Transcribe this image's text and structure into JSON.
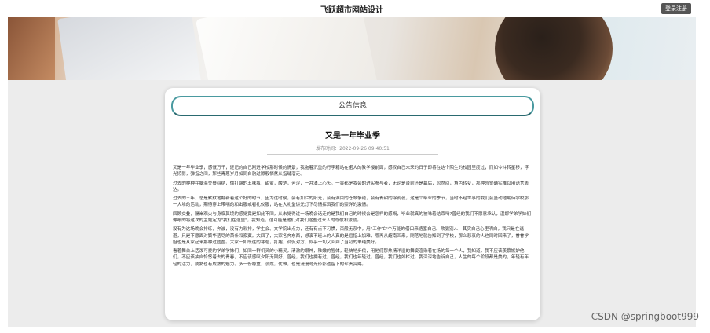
{
  "header": {
    "site_title": "飞跃超市网站设计",
    "login_label": "登录注册"
  },
  "notice": {
    "section_label": "公告信息",
    "title": "又是一年毕业季",
    "publish_time": "发布时间：2022-09-26 09:40:51",
    "paragraphs": [
      "又是一年毕业季，感慨万千，还记的自己刚进学校那时候的情景，我拖着沉重的行李箱站在偌大的教学楼前面，感叹自己未来的日子即将在这个陌生的校园里度过，而如今斗转星移，浮光掠影，弹指之间，那些青葱岁月如同白驹过隙般悄然从指缝溜走。",
      "过去的种种在脑海交叠纠结，像打翻的五味瓶，甜蜜，酸楚，苦涩，一并涌上心头。一香都是我会的进实参与者，无论是台前还是幕后，忽然间，角色转变，那种感觉确实难以用语言表达。",
      "过去的三年，总是默默地翻新着这个好的时节，因为这时候，会有如烂的阳光，会有满目的苍翠争艳，会有青甜的涂鸦夜，这是个毕业的季节，当时不经世事的我们会竖动地期待学校那一大堆的活动，期待穿上带喘的和出服或者礼仪服，站在大礼堂讲光灯下尽情挥洒我们的豪洋的激情。",
      "四顾交叠，隔岸观火与身临其境的感觉竟是如此不同，从未觉得过一场晚会话走的是我们自己的时候会是怎样的感慨，毕业就真的被味着结束吗?曾经的我们不愿意承认，温娜学弟学妹们像嗡的将这次的主题定为\"我们在这里\"，我知道，这可能是他们对我们这些过来人的尊敬和激励。",
      "没有为这场晚会排练，奔波，没有为彩排，学生会、文学院出点力，还有有点不习惯，百般无奈中，用\"工作忙\"个万能的借口来搪塞自己。欺骗别人，其实自己心里明白，我只是在逃避，只是不愿面对繁华落尽的萧条和寂寞。大四了，大家各奔东西，想演不班上的人真的是屈指上加难，哪再从超南回来，刚落地就告知到了学校，那么悲哀的人也同时回来了，眷眷学姐也是从家起来那种过团圆。大家一如既往的寒暄，打趣，调侃对方，似乎一切又回到了当初的单纯美好。",
      "看着舞台上活泼可爱的学弟学妹们，如同一群机灵的小精灵，清澈的眼神，稚嫩的脸体，轻快地步伐，用他们那热情洋溢的舞姿渲染着在场的每一个人，我知道，我不应该羡慕嫉妒他们，不应该抽自怜悠着去的青春，不应该感叹夕阳无限好，曾经，我们也拥有过，曾经，我们也年轻过，曾经，我们也如栏过。我深深地告诉自己，人生的每个阶段都是美的，年轻有年轻的活力，成熟也有成熟的魅力。多一份稳重，淡然，优雅，也是漫漫时光形影遗留下的珍贵赏赐。"
    ]
  },
  "watermark": "CSDN @springboot999",
  "colors": {
    "accent": "#4a9aa0",
    "page_bg": "#ececec"
  }
}
